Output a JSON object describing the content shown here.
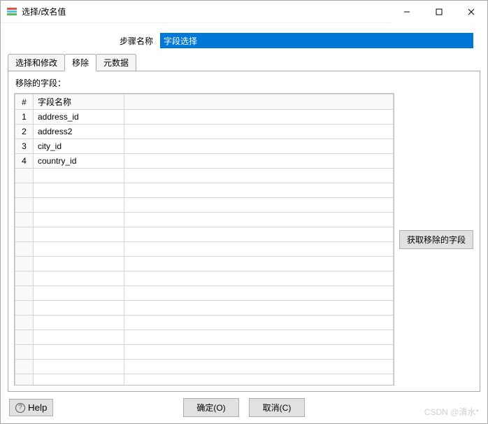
{
  "window": {
    "title": "选择/改名值"
  },
  "step": {
    "label": "步骤名称",
    "value": "字段选择"
  },
  "tabs": [
    {
      "label": "选择和修改",
      "active": false
    },
    {
      "label": "移除",
      "active": true
    },
    {
      "label": "元数据",
      "active": false
    }
  ],
  "remove": {
    "caption": "移除的字段：",
    "columns": {
      "index": "#",
      "name": "字段名称"
    },
    "rows": [
      {
        "idx": "1",
        "name": "address_id"
      },
      {
        "idx": "2",
        "name": "address2"
      },
      {
        "idx": "3",
        "name": "city_id"
      },
      {
        "idx": "4",
        "name": "country_id"
      }
    ],
    "get_fields_button": "获取移除的字段"
  },
  "buttons": {
    "help": "Help",
    "ok": "确定(O)",
    "cancel": "取消(C)"
  },
  "watermark": "CSDN @清水*"
}
